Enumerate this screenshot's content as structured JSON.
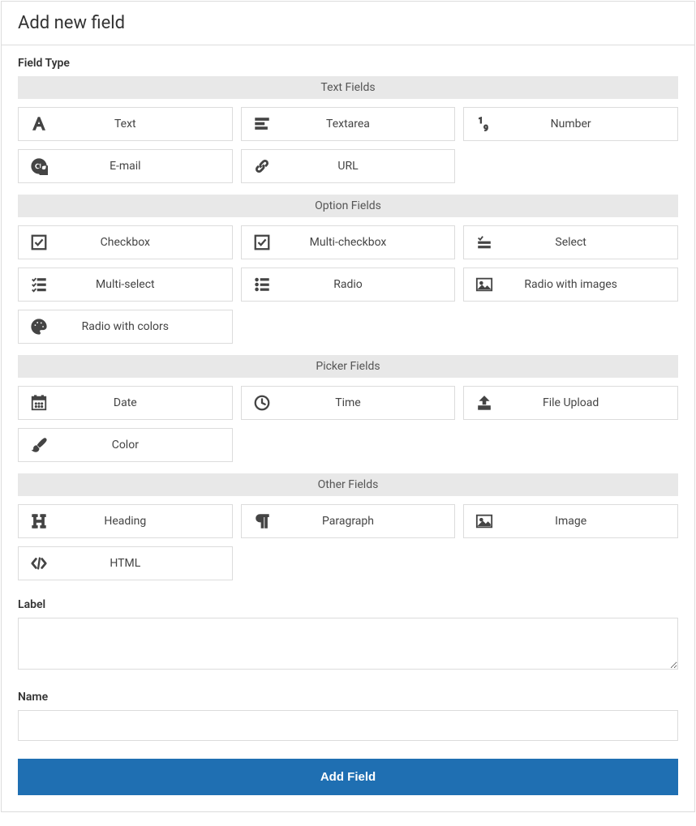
{
  "header_title": "Add new field",
  "field_type": {
    "label": "Field Type",
    "groups": [
      {
        "title": "Text Fields",
        "options": [
          {
            "icon": "font",
            "label": "Text"
          },
          {
            "icon": "align-left",
            "label": "Textarea"
          },
          {
            "icon": "number",
            "label": "Number"
          },
          {
            "icon": "at",
            "label": "E-mail"
          },
          {
            "icon": "link",
            "label": "URL"
          }
        ]
      },
      {
        "title": "Option Fields",
        "options": [
          {
            "icon": "check-square",
            "label": "Checkbox"
          },
          {
            "icon": "check-square",
            "label": "Multi-checkbox"
          },
          {
            "icon": "check-list",
            "label": "Select"
          },
          {
            "icon": "list-check",
            "label": "Multi-select"
          },
          {
            "icon": "list-ul",
            "label": "Radio"
          },
          {
            "icon": "image-frame",
            "label": "Radio with images"
          },
          {
            "icon": "palette",
            "label": "Radio with colors"
          }
        ]
      },
      {
        "title": "Picker Fields",
        "options": [
          {
            "icon": "calendar",
            "label": "Date"
          },
          {
            "icon": "clock",
            "label": "Time"
          },
          {
            "icon": "upload",
            "label": "File Upload"
          },
          {
            "icon": "brush",
            "label": "Color"
          }
        ]
      },
      {
        "title": "Other Fields",
        "options": [
          {
            "icon": "heading",
            "label": "Heading"
          },
          {
            "icon": "paragraph",
            "label": "Paragraph"
          },
          {
            "icon": "image",
            "label": "Image"
          },
          {
            "icon": "code",
            "label": "HTML"
          }
        ]
      }
    ]
  },
  "label_field": {
    "label": "Label",
    "value": ""
  },
  "name_field": {
    "label": "Name",
    "value": ""
  },
  "submit_label": "Add Field"
}
